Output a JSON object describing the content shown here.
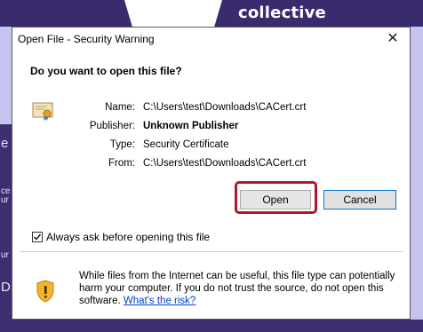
{
  "background": {
    "brand": "collective",
    "edge_fragments": [
      "e",
      "ce",
      "ur",
      "ur",
      "DS"
    ]
  },
  "dialog": {
    "title": "Open File - Security Warning",
    "close_symbol": "✕",
    "question": "Do you want to open this file?",
    "fields": {
      "name_label": "Name:",
      "name_value": "C:\\Users\\test\\Downloads\\CACert.crt",
      "publisher_label": "Publisher:",
      "publisher_value": "Unknown Publisher",
      "type_label": "Type:",
      "type_value": "Security Certificate",
      "from_label": "From:",
      "from_value": "C:\\Users\\test\\Downloads\\CACert.crt"
    },
    "buttons": {
      "open": "Open",
      "cancel": "Cancel"
    },
    "checkbox": {
      "label": "Always ask before opening this file",
      "checked": true
    },
    "warning": {
      "text": "While files from the Internet can be useful, this file type can potentially harm your computer. If you do not trust the source, do not open this software.",
      "link": "What's the risk?"
    },
    "icons": {
      "file": "certificate-icon",
      "warning": "shield-warning-icon"
    },
    "colors": {
      "highlight": "#b0182a",
      "accent": "#0078d7",
      "link": "#0044cc"
    }
  }
}
